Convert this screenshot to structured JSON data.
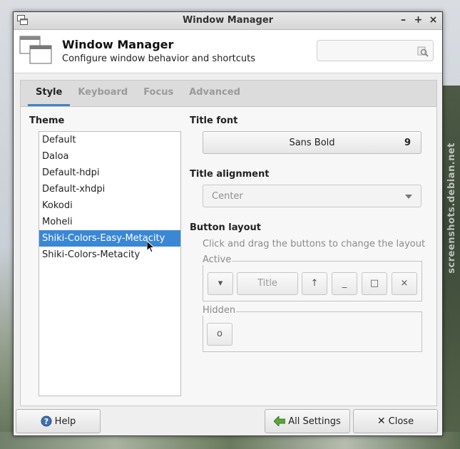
{
  "window": {
    "title": "Window Manager",
    "minimize": "–",
    "maximize": "+",
    "close": "×"
  },
  "header": {
    "title": "Window Manager",
    "subtitle": "Configure window behavior and shortcuts",
    "search_placeholder": ""
  },
  "tabs": [
    {
      "label": "Style",
      "active": true
    },
    {
      "label": "Keyboard",
      "active": false
    },
    {
      "label": "Focus",
      "active": false
    },
    {
      "label": "Advanced",
      "active": false
    }
  ],
  "theme": {
    "label": "Theme",
    "items": [
      "Default",
      "Daloa",
      "Default-hdpi",
      "Default-xhdpi",
      "Kokodi",
      "Moheli",
      "Shiki-Colors-Easy-Metacity",
      "Shiki-Colors-Metacity"
    ],
    "selected_index": 6
  },
  "title_font": {
    "label": "Title font",
    "name": "Sans Bold",
    "size": "9"
  },
  "title_alignment": {
    "label": "Title alignment",
    "value": "Center"
  },
  "button_layout": {
    "label": "Button layout",
    "hint": "Click and drag the buttons to change the layout",
    "active_label": "Active",
    "hidden_label": "Hidden",
    "active_buttons": {
      "menu": "▾",
      "title": "Title",
      "shade": "↑",
      "minimize": "_",
      "maximize": "□",
      "close": "×"
    },
    "hidden_buttons": {
      "stick": "o"
    }
  },
  "buttons": {
    "help": "Help",
    "all_settings": "All Settings",
    "close": "Close"
  },
  "background": {
    "watermark": "screenshots.debian.net"
  },
  "colors": {
    "selection": "#3a87d6",
    "tab_accent": "#3f84c6"
  }
}
